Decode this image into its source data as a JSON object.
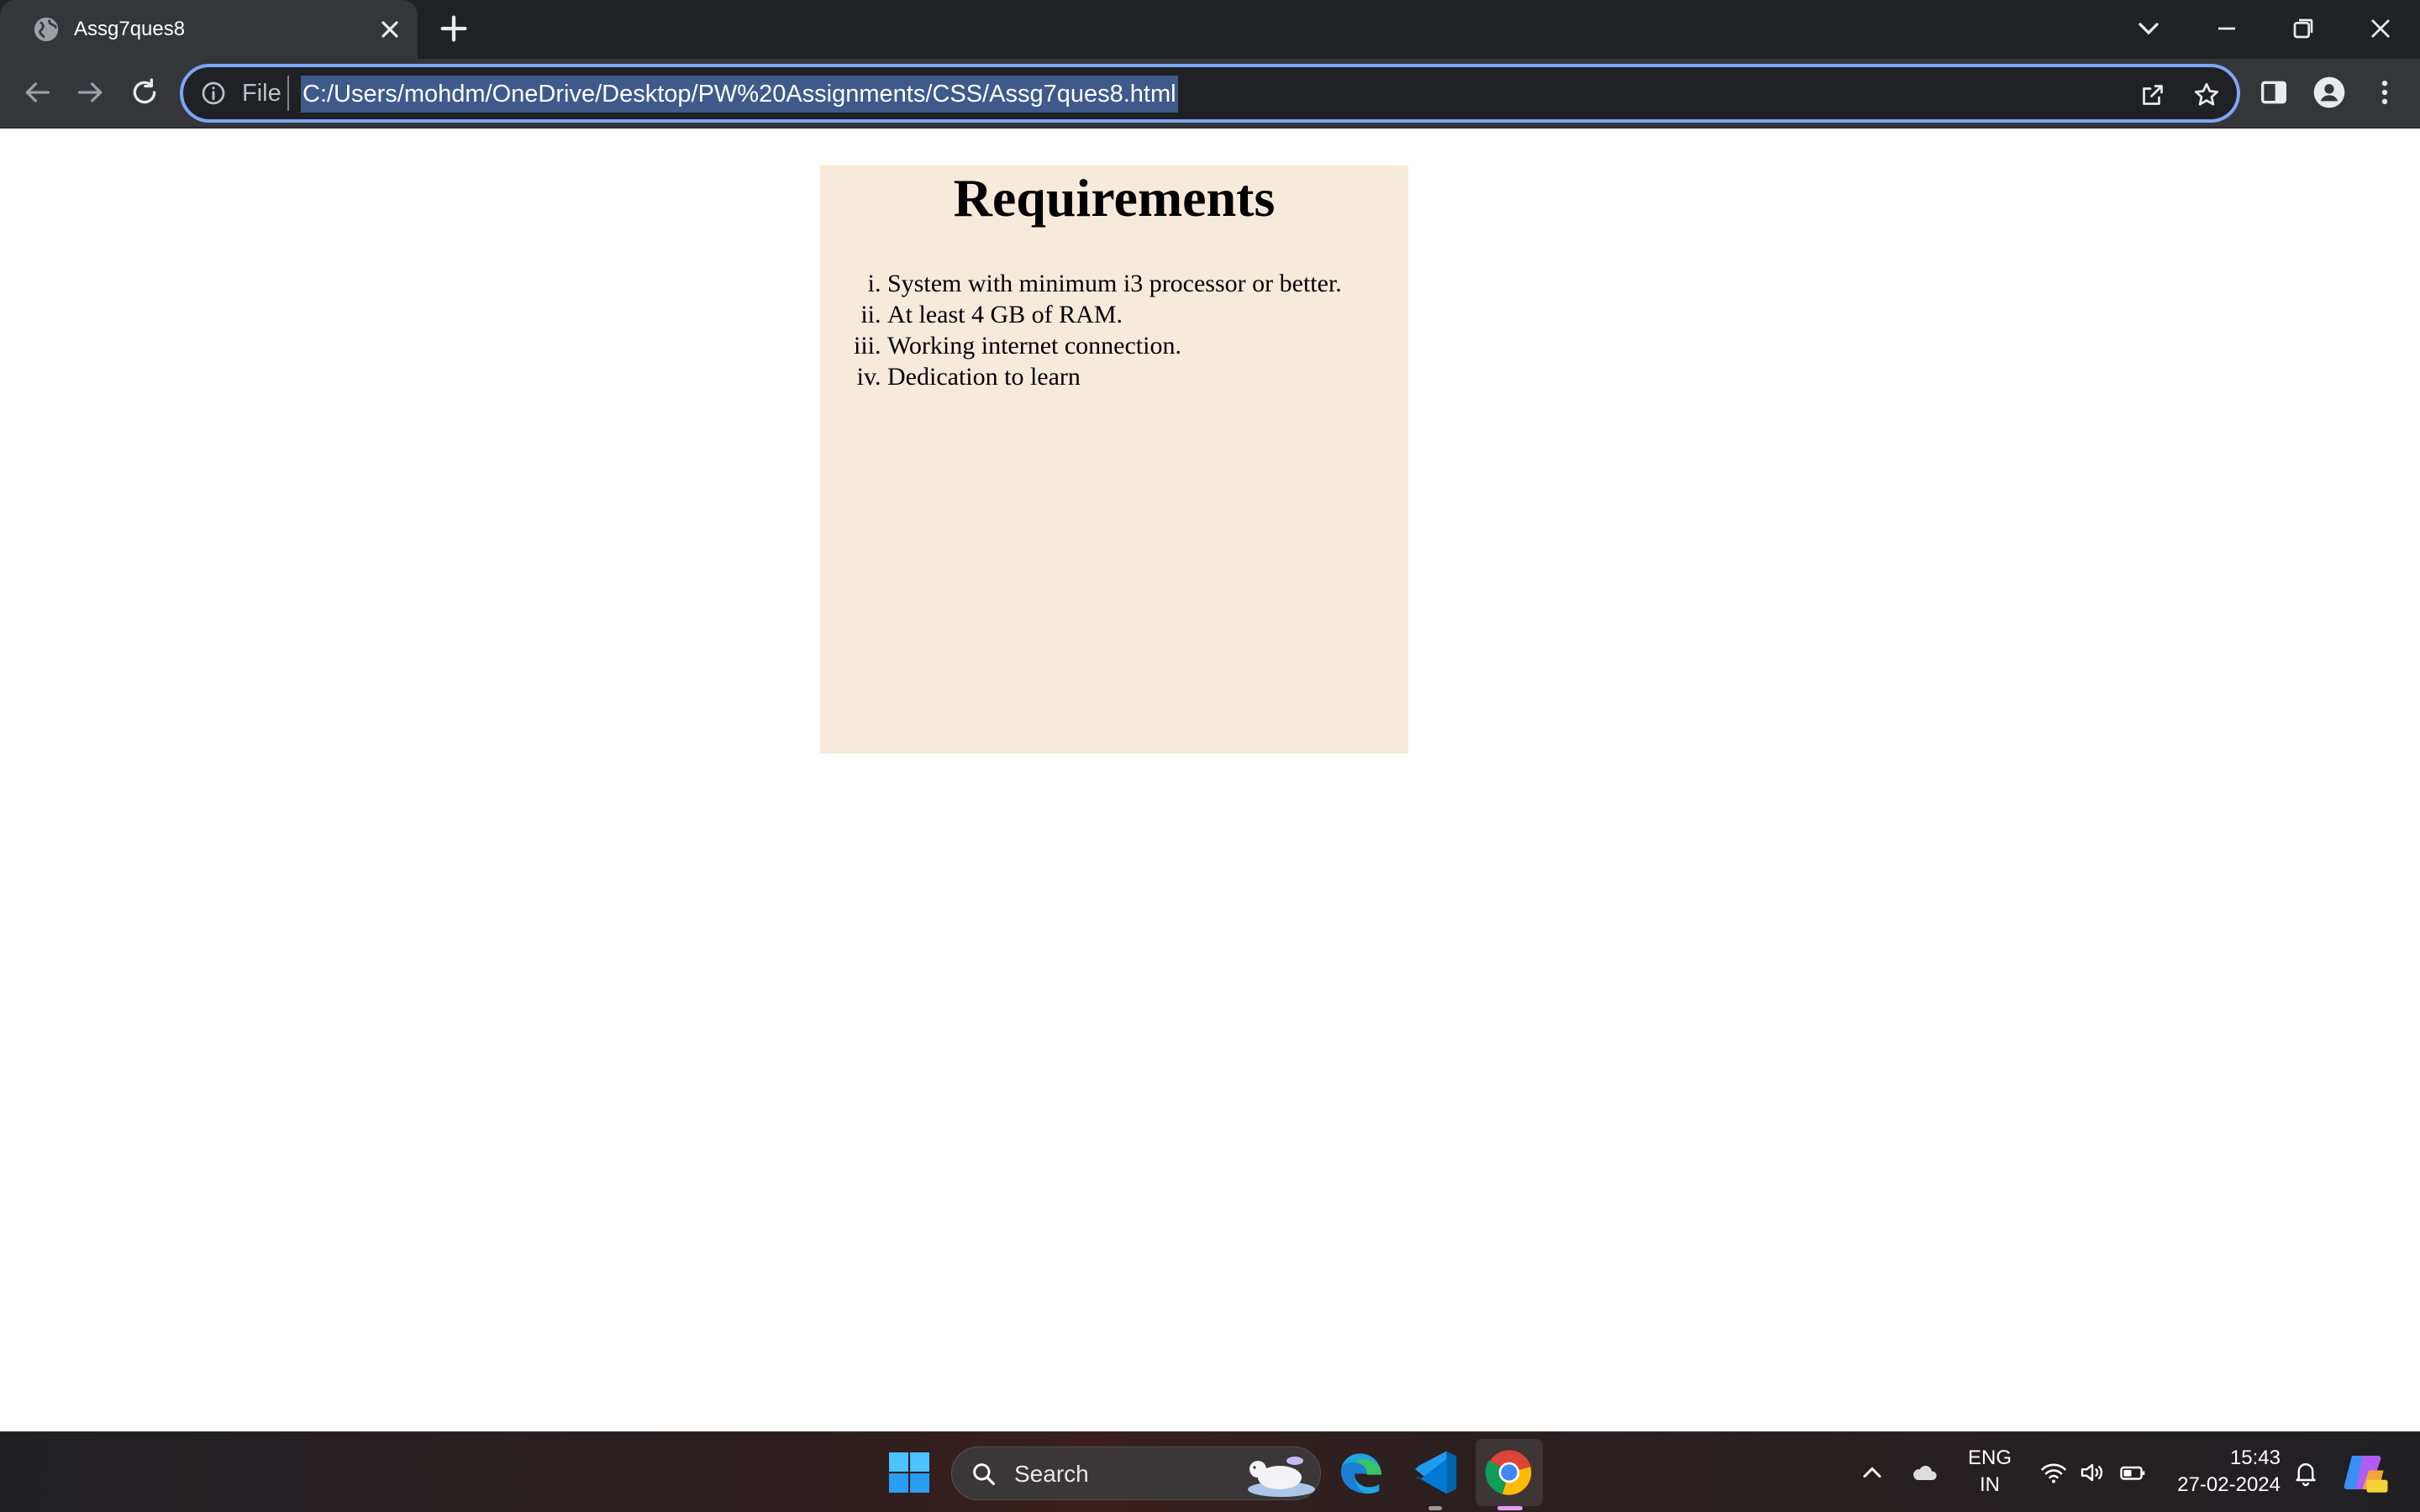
{
  "browser": {
    "tab": {
      "title": "Assg7ques8",
      "favicon": "globe-icon"
    },
    "address_bar": {
      "scheme_label": "File",
      "url": "C:/Users/mohdm/OneDrive/Desktop/PW%20Assignments/CSS/Assg7ques8.html"
    }
  },
  "page": {
    "heading": "Requirements",
    "requirements": [
      "System with minimum i3 processor or better.",
      "At least 4 GB of RAM.",
      "Working internet connection.",
      "Dedication to learn"
    ]
  },
  "taskbar": {
    "search_label": "Search",
    "language": {
      "line1": "ENG",
      "line2": "IN"
    },
    "clock": {
      "time": "15:43",
      "date": "27-02-2024"
    }
  },
  "colors": {
    "address_focus": "#7ca6f7",
    "box_background": "#f6eadb",
    "chrome_dark": "#202124",
    "chrome_toolbar": "#35363a"
  }
}
